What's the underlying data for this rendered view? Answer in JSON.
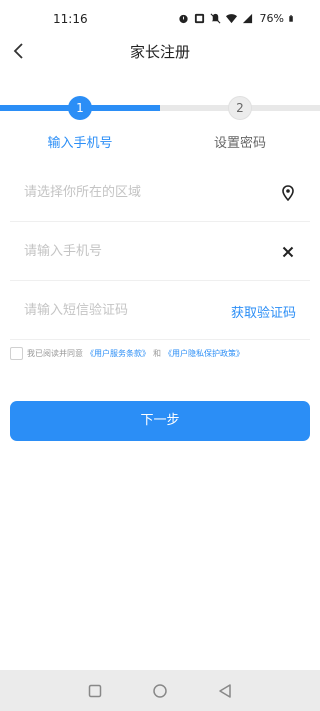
{
  "status_bar": {
    "time": "11:16",
    "battery": "76%"
  },
  "header": {
    "title": "家长注册"
  },
  "steps": [
    {
      "number": "1",
      "label": "输入手机号"
    },
    {
      "number": "2",
      "label": "设置密码"
    }
  ],
  "form": {
    "region_placeholder": "请选择你所在的区域",
    "phone_placeholder": "请输入手机号",
    "code_placeholder": "请输入短信验证码",
    "get_code_label": "获取验证码"
  },
  "agreement": {
    "prefix": "我已阅读并同意",
    "terms_link": "《用户服务条款》",
    "conjunction": "和",
    "privacy_link": "《用户隐私保护政策》"
  },
  "next_button": "下一步",
  "colors": {
    "accent": "#2b8ef6",
    "inactive": "#e8e8e8"
  },
  "icons": [
    "back-icon",
    "location-icon",
    "clear-icon",
    "square-nav-icon",
    "circle-nav-icon",
    "triangle-back-nav-icon"
  ]
}
